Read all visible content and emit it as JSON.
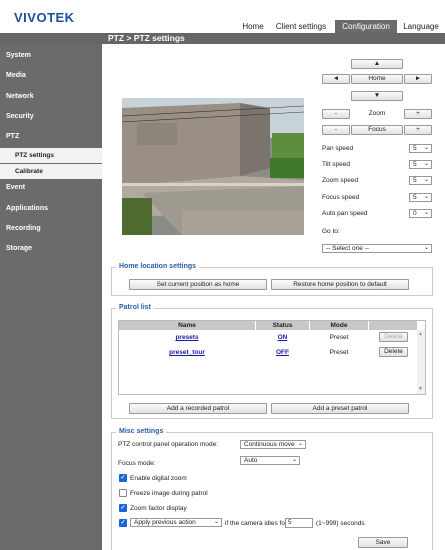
{
  "brand": "VIVOTEK",
  "topnav": [
    "Home",
    "Client settings",
    "Configuration",
    "Language"
  ],
  "breadcrumb": "PTZ  > PTZ settings",
  "sidebar": {
    "items": [
      "System",
      "Media",
      "Network",
      "Security",
      "PTZ",
      "Event",
      "Applications",
      "Recording",
      "Storage"
    ],
    "sub": [
      "PTZ settings",
      "Calibrate"
    ]
  },
  "ptz": {
    "up": "▲",
    "down": "▼",
    "left": "◄",
    "right": "►",
    "home": "Home",
    "zoom_label": "Zoom",
    "focus_label": "Focus",
    "minus": "-",
    "plus": "+",
    "speeds": [
      {
        "label": "Pan speed",
        "value": "5"
      },
      {
        "label": "Tilt speed",
        "value": "5"
      },
      {
        "label": "Zoom speed",
        "value": "5"
      },
      {
        "label": "Focus speed",
        "value": "5"
      },
      {
        "label": "Auto pan speed",
        "value": "0"
      }
    ],
    "goto_label": "Go to:",
    "goto_value": "-- Select one --"
  },
  "home_location": {
    "title": "Home location settings",
    "set_btn": "Set current position as home",
    "restore_btn": "Restore home position to default"
  },
  "patrol": {
    "title": "Patrol list",
    "headers": [
      "Name",
      "Status",
      "Mode"
    ],
    "rows": [
      {
        "name": "presets",
        "status": "ON",
        "mode": "Preset",
        "action": "Delete"
      },
      {
        "name": "preset_tour",
        "status": "OFF",
        "mode": "Preset",
        "action": "Delete"
      }
    ],
    "add_recorded": "Add a recorded patrol",
    "add_preset": "Add a preset patrol"
  },
  "misc": {
    "title": "Misc settings",
    "op_mode_label": "PTZ control panel operation mode:",
    "op_mode_value": "Continuous move",
    "focus_label": "Focus mode:",
    "focus_value": "Auto",
    "digital_zoom": "Enable digital zoom",
    "freeze": "Freeze image during patrol",
    "zoom_factor": "Zoom factor display",
    "apply_action": "Apply previous action",
    "idle_text": "if the camera idles for",
    "idle_value": "5",
    "idle_range": "(1~999) seconds",
    "save": "Save"
  },
  "colors": {
    "brand": "#1b4f9c",
    "sidebar": "#6b6b6b",
    "section_title": "#2a5ca8",
    "checkbox": "#1a66d6"
  }
}
